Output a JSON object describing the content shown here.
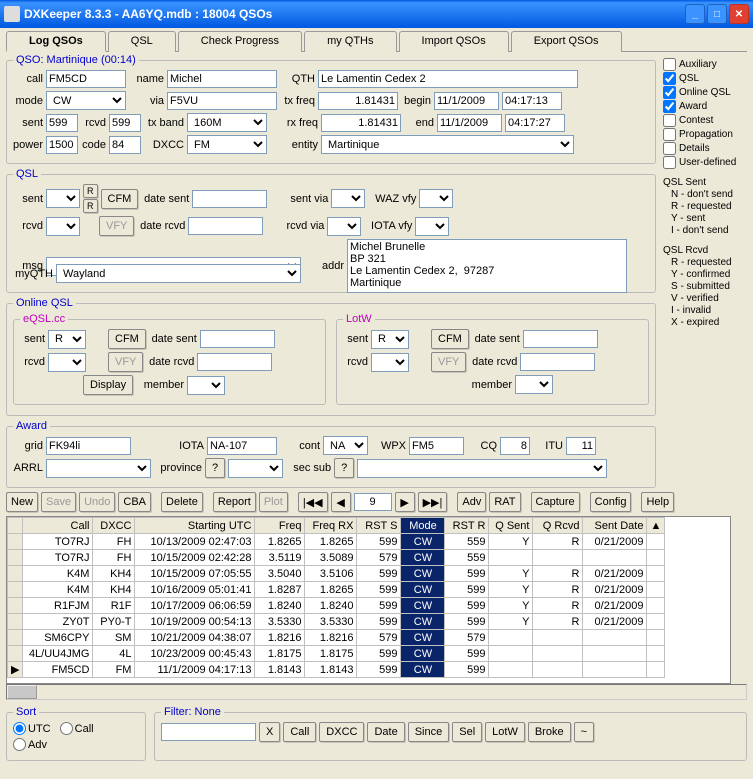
{
  "window": {
    "title": "DXKeeper 8.3.3 - AA6YQ.mdb : 18004 QSOs"
  },
  "tabs": [
    "Log QSOs",
    "QSL",
    "Check Progress",
    "my QTHs",
    "Import QSOs",
    "Export QSOs"
  ],
  "side_checks": [
    {
      "label": "Auxiliary",
      "checked": false
    },
    {
      "label": "QSL",
      "checked": true
    },
    {
      "label": "Online QSL",
      "checked": true
    },
    {
      "label": "Award",
      "checked": true
    },
    {
      "label": "Contest",
      "checked": false
    },
    {
      "label": "Propagation",
      "checked": false
    },
    {
      "label": "Details",
      "checked": false
    },
    {
      "label": "User-defined",
      "checked": false
    }
  ],
  "legend_sent": {
    "title": "QSL Sent",
    "items": [
      "N - don't send",
      "R - requested",
      "Y - sent",
      "I - don't send"
    ]
  },
  "legend_rcvd": {
    "title": "QSL Rcvd",
    "items": [
      "R - requested",
      "Y - confirmed",
      "S - submitted",
      "V - verified",
      "I - invalid",
      "X - expired"
    ]
  },
  "qso": {
    "legend": "QSO: Martinique (00:14)",
    "call_lbl": "call",
    "call": "FM5CD",
    "name_lbl": "name",
    "name": "Michel",
    "qth_lbl": "QTH",
    "qth": "Le Lamentin Cedex 2",
    "mode_lbl": "mode",
    "mode": "CW",
    "via_lbl": "via",
    "via": "F5VU",
    "txfreq_lbl": "tx freq",
    "txfreq": "1.81431",
    "begin_lbl": "begin",
    "begin_date": "11/1/2009",
    "begin_time": "04:17:13",
    "sent_lbl": "sent",
    "sent": "599",
    "rcvd_lbl": "rcvd",
    "rcvd": "599",
    "txband_lbl": "tx band",
    "txband": "160M",
    "rxfreq_lbl": "rx freq",
    "rxfreq": "1.81431",
    "end_lbl": "end",
    "end_date": "11/1/2009",
    "end_time": "04:17:27",
    "power_lbl": "power",
    "power": "1500",
    "code_lbl": "code",
    "code": "84",
    "dxcc_lbl": "DXCC",
    "dxcc": "FM",
    "entity_lbl": "entity",
    "entity": "Martinique"
  },
  "qsl": {
    "legend": "QSL",
    "sent_lbl": "sent",
    "cfm": "CFM",
    "date_sent_lbl": "date sent",
    "sent_via_lbl": "sent via",
    "waz_lbl": "WAZ vfy",
    "rcvd_lbl": "rcvd",
    "vfy": "VFY",
    "date_rcvd_lbl": "date rcvd",
    "rcvd_via_lbl": "rcvd via",
    "iota_lbl": "IOTA vfy",
    "msg_lbl": "msg",
    "addr_lbl": "addr",
    "addr": "Michel Brunelle\nBP 321\nLe Lamentin Cedex 2,  97287\nMartinique",
    "myqth_lbl": "myQTH",
    "myqth": "Wayland",
    "r_btn": "R"
  },
  "online": {
    "legend": "Online QSL",
    "eqsl_legend": "eQSL.cc",
    "lotw_legend": "LotW",
    "sent_lbl": "sent",
    "sent_val": "R",
    "cfm": "CFM",
    "date_sent_lbl": "date sent",
    "rcvd_lbl": "rcvd",
    "vfy": "VFY",
    "date_rcvd_lbl": "date rcvd",
    "display": "Display",
    "member_lbl": "member"
  },
  "award": {
    "legend": "Award",
    "grid_lbl": "grid",
    "grid": "FK94li",
    "iota_lbl": "IOTA",
    "iota": "NA-107",
    "cont_lbl": "cont",
    "cont": "NA",
    "wpx_lbl": "WPX",
    "wpx": "FM5",
    "cq_lbl": "CQ",
    "cq": "8",
    "itu_lbl": "ITU",
    "itu": "11",
    "arrl_lbl": "ARRL",
    "province_lbl": "province",
    "province_btn": "?",
    "secsub_lbl": "sec sub",
    "secsub_btn": "?"
  },
  "toolbar": {
    "new": "New",
    "save": "Save",
    "undo": "Undo",
    "cba": "CBA",
    "delete": "Delete",
    "report": "Report",
    "plot": "Plot",
    "first": "|◀◀",
    "prev": "◀",
    "pos": "9",
    "next": "▶",
    "last": "▶▶|",
    "adv": "Adv",
    "rat": "RAT",
    "capture": "Capture",
    "config": "Config",
    "help": "Help"
  },
  "gridcols": [
    "Call",
    "DXCC",
    "Starting UTC",
    "Freq",
    "Freq RX",
    "RST S",
    "Mode",
    "RST R",
    "Q Sent",
    "Q Rcvd",
    "Sent Date"
  ],
  "gridrows": [
    {
      "Call": "TO7RJ",
      "DXCC": "FH",
      "Starting UTC": "10/13/2009  02:47:03",
      "Freq": "1.8265",
      "Freq RX": "1.8265",
      "RST S": "599",
      "Mode": "CW",
      "RST R": "559",
      "Q Sent": "Y",
      "Q Rcvd": "R",
      "Sent Date": "0/21/2009"
    },
    {
      "Call": "TO7RJ",
      "DXCC": "FH",
      "Starting UTC": "10/15/2009  02:42:28",
      "Freq": "3.5119",
      "Freq RX": "3.5089",
      "RST S": "579",
      "Mode": "CW",
      "RST R": "559",
      "Q Sent": "",
      "Q Rcvd": "",
      "Sent Date": ""
    },
    {
      "Call": "K4M",
      "DXCC": "KH4",
      "Starting UTC": "10/15/2009  07:05:55",
      "Freq": "3.5040",
      "Freq RX": "3.5106",
      "RST S": "599",
      "Mode": "CW",
      "RST R": "599",
      "Q Sent": "Y",
      "Q Rcvd": "R",
      "Sent Date": "0/21/2009"
    },
    {
      "Call": "K4M",
      "DXCC": "KH4",
      "Starting UTC": "10/16/2009  05:01:41",
      "Freq": "1.8287",
      "Freq RX": "1.8265",
      "RST S": "599",
      "Mode": "CW",
      "RST R": "599",
      "Q Sent": "Y",
      "Q Rcvd": "R",
      "Sent Date": "0/21/2009"
    },
    {
      "Call": "R1FJM",
      "DXCC": "R1F",
      "Starting UTC": "10/17/2009  06:06:59",
      "Freq": "1.8240",
      "Freq RX": "1.8240",
      "RST S": "599",
      "Mode": "CW",
      "RST R": "599",
      "Q Sent": "Y",
      "Q Rcvd": "R",
      "Sent Date": "0/21/2009"
    },
    {
      "Call": "ZY0T",
      "DXCC": "PY0-T",
      "Starting UTC": "10/19/2009  00:54:13",
      "Freq": "3.5330",
      "Freq RX": "3.5330",
      "RST S": "599",
      "Mode": "CW",
      "RST R": "599",
      "Q Sent": "Y",
      "Q Rcvd": "R",
      "Sent Date": "0/21/2009"
    },
    {
      "Call": "SM6CPY",
      "DXCC": "SM",
      "Starting UTC": "10/21/2009  04:38:07",
      "Freq": "1.8216",
      "Freq RX": "1.8216",
      "RST S": "579",
      "Mode": "CW",
      "RST R": "579",
      "Q Sent": "",
      "Q Rcvd": "",
      "Sent Date": ""
    },
    {
      "Call": "4L/UU4JMG",
      "DXCC": "4L",
      "Starting UTC": "10/23/2009  00:45:43",
      "Freq": "1.8175",
      "Freq RX": "1.8175",
      "RST S": "599",
      "Mode": "CW",
      "RST R": "599",
      "Q Sent": "",
      "Q Rcvd": "",
      "Sent Date": ""
    },
    {
      "Call": "FM5CD",
      "DXCC": "FM",
      "Starting UTC": "11/1/2009  04:17:13",
      "Freq": "1.8143",
      "Freq RX": "1.8143",
      "RST S": "599",
      "Mode": "CW",
      "RST R": "599",
      "Q Sent": "",
      "Q Rcvd": "",
      "Sent Date": ""
    }
  ],
  "sort": {
    "legend": "Sort",
    "utc": "UTC",
    "call": "Call",
    "adv": "Adv"
  },
  "filter": {
    "legend": "Filter: None",
    "x": "X",
    "call": "Call",
    "dxcc": "DXCC",
    "date": "Date",
    "since": "Since",
    "sel": "Sel",
    "lotw": "LotW",
    "broke": "Broke",
    "tilde": "~"
  }
}
